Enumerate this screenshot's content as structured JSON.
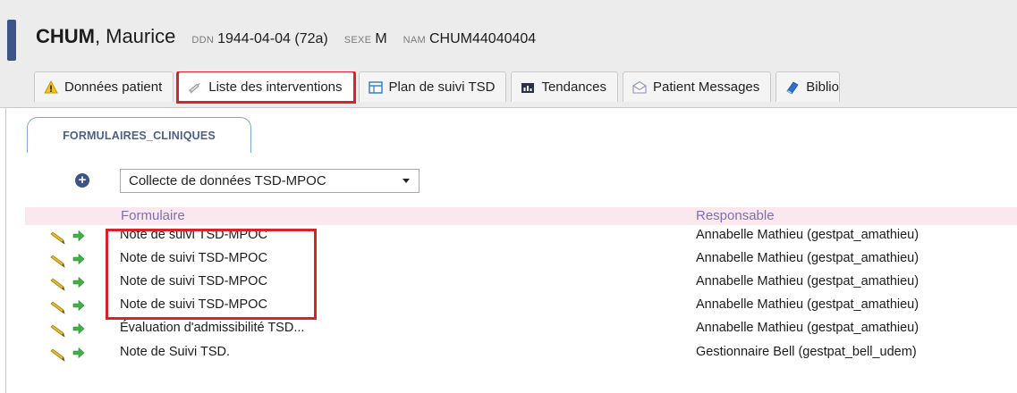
{
  "patient": {
    "last_name": "CHUM",
    "first_name": "Maurice",
    "ddn_label": "DDN",
    "ddn_value": "1944-04-04 (72a)",
    "sexe_label": "SEXE",
    "sexe_value": "M",
    "nam_label": "NAM",
    "nam_value": "CHUM44040404"
  },
  "tabs": [
    {
      "label": "Données patient",
      "icon": "warning-icon"
    },
    {
      "label": "Liste des interventions",
      "icon": "syringe-icon",
      "active": true
    },
    {
      "label": "Plan de suivi TSD",
      "icon": "table-icon"
    },
    {
      "label": "Tendances",
      "icon": "chart-icon"
    },
    {
      "label": "Patient Messages",
      "icon": "envelope-icon"
    },
    {
      "label": "Biblio",
      "icon": "book-icon"
    }
  ],
  "subtab": {
    "label": "FORMULAIRES_CLINIQUES"
  },
  "form_select": {
    "selected": "Collecte de données TSD-MPOC"
  },
  "table": {
    "headers": {
      "formulaire": "Formulaire",
      "responsable": "Responsable"
    },
    "rows": [
      {
        "formulaire": "Note de suivi TSD-MPOC",
        "responsable": "Annabelle Mathieu (gestpat_amathieu)"
      },
      {
        "formulaire": "Note de suivi TSD-MPOC",
        "responsable": "Annabelle Mathieu (gestpat_amathieu)"
      },
      {
        "formulaire": "Note de suivi TSD-MPOC",
        "responsable": "Annabelle Mathieu (gestpat_amathieu)"
      },
      {
        "formulaire": "Note de suivi TSD-MPOC",
        "responsable": "Annabelle Mathieu (gestpat_amathieu)"
      },
      {
        "formulaire": "Évaluation d'admissibilité TSD...",
        "responsable": "Annabelle Mathieu (gestpat_amathieu)"
      },
      {
        "formulaire": "Note de Suivi TSD.",
        "responsable": "Gestionnaire Bell (gestpat_bell_udem)"
      }
    ]
  },
  "colors": {
    "accent": "#3d5487",
    "highlight": "#d9232b",
    "header_row": "#fbe8ee",
    "column_header_text": "#7b70b5"
  }
}
